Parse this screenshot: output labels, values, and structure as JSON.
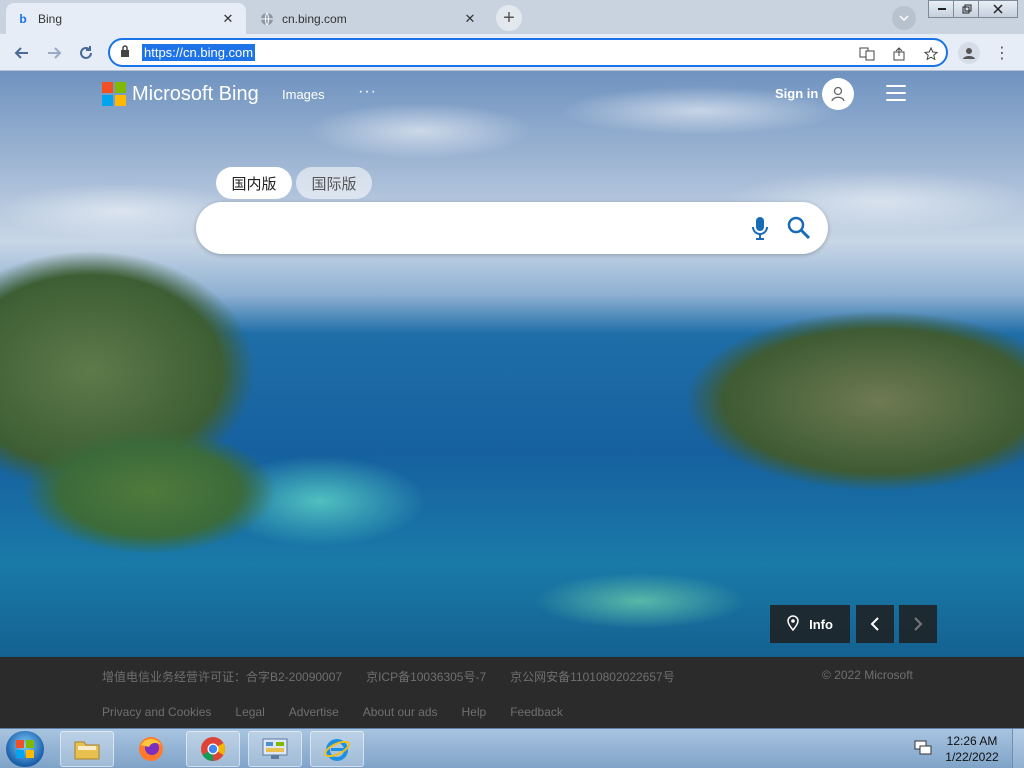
{
  "browser": {
    "tabs": [
      {
        "title": "Bing",
        "favicon": "bing-icon",
        "active": true
      },
      {
        "title": "cn.bing.com",
        "favicon": "globe-icon",
        "active": false
      }
    ],
    "new_tab_label": "+",
    "address": "https://cn.bing.com",
    "close_glyph": "✕"
  },
  "page": {
    "brand": "Microsoft Bing",
    "nav": {
      "images": "Images",
      "more": "···"
    },
    "signin": "Sign in",
    "regions": {
      "domestic": "国内版",
      "international": "国际版"
    },
    "search_placeholder": "",
    "info_label": "Info",
    "footer": {
      "license": "增值电信业务经营许可证：合字B2-20090007",
      "icp": "京ICP备10036305号-7",
      "security": "京公网安备11010802022657号",
      "copyright": "© 2022 Microsoft",
      "links": [
        "Privacy and Cookies",
        "Legal",
        "Advertise",
        "About our ads",
        "Help",
        "Feedback"
      ]
    }
  },
  "taskbar": {
    "time": "12:26 AM",
    "date": "1/22/2022",
    "apps": [
      "file-explorer",
      "firefox",
      "chrome",
      "control-panel",
      "internet-explorer"
    ]
  },
  "colors": {
    "accent": "#1a73e8",
    "ms_red": "#f25022",
    "ms_green": "#7fba00",
    "ms_blue": "#00a4ef",
    "ms_yellow": "#ffb900"
  }
}
